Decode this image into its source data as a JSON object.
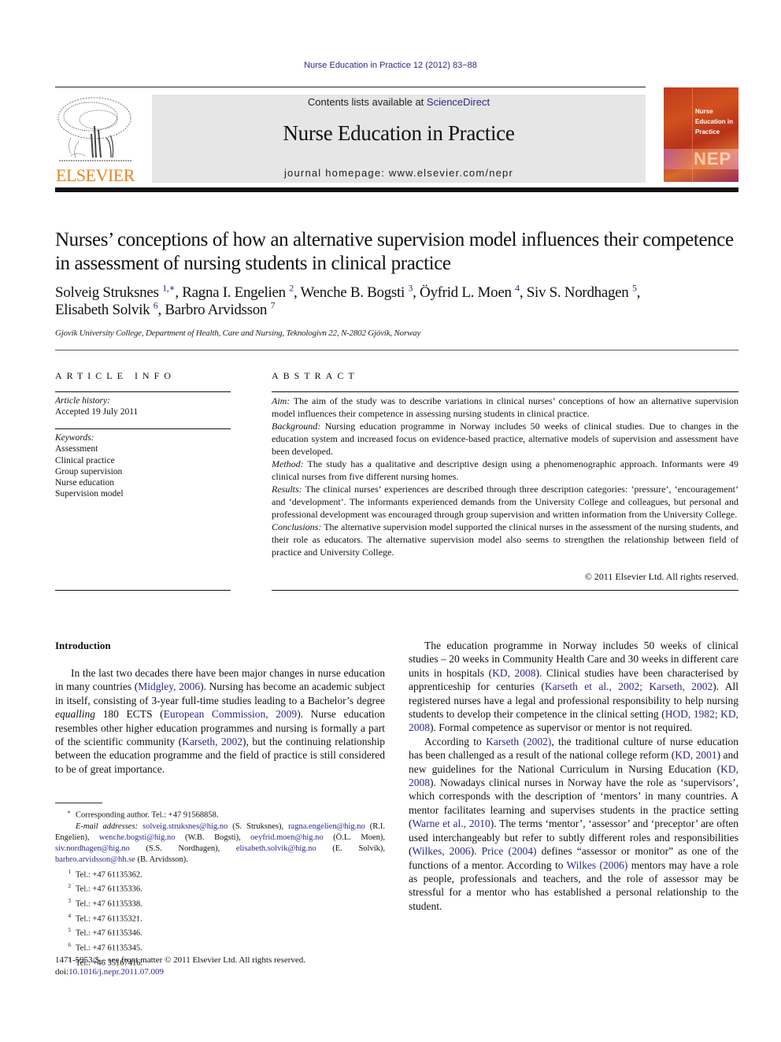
{
  "running_head": "Nurse Education in Practice 12 (2012) 83−88",
  "masthead": {
    "contents_prefix": "Contents lists available at ",
    "contents_link": "ScienceDirect",
    "journal_title": "Nurse Education in Practice",
    "homepage": "journal homepage: www.elsevier.com/nepr",
    "publisher_logo_text": "ELSEVIER",
    "cover": {
      "title_lines": [
        "Nurse",
        "Education in",
        "Practice"
      ],
      "abbrev": "NEP"
    }
  },
  "colors": {
    "link": "#2a2a8a",
    "elsevier_orange": "#e8821e",
    "masthead_bg": "#e6e6e6",
    "cover_red": "#c03a1c"
  },
  "article": {
    "title": "Nurses’ conceptions of how an alternative supervision model influences their competence in assessment of nursing students in clinical practice",
    "authors": [
      {
        "name": "Solveig Struksnes",
        "sup": "1,∗"
      },
      {
        "name": "Ragna I. Engelien",
        "sup": "2"
      },
      {
        "name": "Wenche B. Bogsti",
        "sup": "3"
      },
      {
        "name": "Öyfrid L. Moen",
        "sup": "4"
      },
      {
        "name": "Siv S. Nordhagen",
        "sup": "5"
      },
      {
        "name": "Elisabeth Solvik",
        "sup": "6"
      },
      {
        "name": "Barbro Arvidsson",
        "sup": "7"
      }
    ],
    "affiliation": "Gjovik University College, Department of Health, Care and Nursing, Teknologivn 22, N-2802 Gjövik, Norway"
  },
  "article_info": {
    "heading": "ARTICLE INFO",
    "history_label": "Article history:",
    "history_value": "Accepted 19 July 2011",
    "keywords_label": "Keywords:",
    "keywords": [
      "Assessment",
      "Clinical practice",
      "Group supervision",
      "Nurse education",
      "Supervision model"
    ]
  },
  "abstract": {
    "heading": "ABSTRACT",
    "sections": [
      {
        "label": "Aim:",
        "text": " The aim of the study was to describe variations in clinical nurses’ conceptions of how an alternative supervision model influences their competence in assessing nursing students in clinical practice."
      },
      {
        "label": "Background:",
        "text": " Nursing education programme in Norway includes 50 weeks of clinical studies. Due to changes in the education system and increased focus on evidence-based practice, alternative models of supervision and assessment have been developed."
      },
      {
        "label": "Method:",
        "text": " The study has a qualitative and descriptive design using a phenomenographic approach. Informants were 49 clinical nurses from five different nursing homes."
      },
      {
        "label": "Results:",
        "text": " The clinical nurses’ experiences are described through three description categories: ‘pressure’, ‘encouragement’ and ‘development’. The informants experienced demands from the University College and colleagues, but personal and professional development was encouraged through group supervision and written information from the University College."
      },
      {
        "label": "Conclusions:",
        "text": " The alternative supervision model supported the clinical nurses in the assessment of the nursing students, and their role as educators. The alternative supervision model also seems to strengthen the relationship between field of practice and University College."
      }
    ],
    "copyright": "© 2011 Elsevier Ltd. All rights reserved."
  },
  "body": {
    "intro_heading": "Introduction",
    "left_paragraph": [
      {
        "t": "In the last two decades there have been major changes in nurse education in many countries ("
      },
      {
        "link": "Midgley, 2006"
      },
      {
        "t": "). Nursing has become an academic subject in itself, consisting of 3-year full-time studies leading to a Bachelor’s degree "
      },
      {
        "em": "equalling"
      },
      {
        "t": " 180 ECTS ("
      },
      {
        "link": "European Commission, 2009"
      },
      {
        "t": "). Nurse education resembles other higher education programmes and nursing is formally a part of the scientific community ("
      },
      {
        "link": "Karseth, 2002"
      },
      {
        "t": "), but the continuing relationship between the education programme and the field of practice is still considered to be of great importance."
      }
    ],
    "right_paragraphs": [
      [
        {
          "t": "The education programme in Norway includes 50 weeks of clinical studies – 20 weeks in Community Health Care and 30 weeks in different care units in hospitals ("
        },
        {
          "link": "KD, 2008"
        },
        {
          "t": "). Clinical studies have been characterised by apprenticeship for centuries ("
        },
        {
          "link": "Karseth et al., 2002; Karseth, 2002"
        },
        {
          "t": "). All registered nurses have a legal and professional responsibility to help nursing students to develop their competence in the clinical setting ("
        },
        {
          "link": "HOD, 1982; KD, 2008"
        },
        {
          "t": "). Formal competence as supervisor or mentor is not required."
        }
      ],
      [
        {
          "t": "According to "
        },
        {
          "link": "Karseth (2002)"
        },
        {
          "t": ", the traditional culture of nurse education has been challenged as a result of the national college reform ("
        },
        {
          "link": "KD, 2001"
        },
        {
          "t": ") and new guidelines for the National Curriculum in Nursing Education ("
        },
        {
          "link": "KD, 2008"
        },
        {
          "t": "). Nowadays clinical nurses in Norway have the role as ‘supervisors’, which corresponds with the description of ‘mentors’ in many countries. A mentor facilitates learning and supervises students in the practice setting ("
        },
        {
          "link": "Warne et al., 2010"
        },
        {
          "t": "). The terms ‘mentor’, ‘assessor’ and ‘preceptor’ are often used interchangeably but refer to subtly different roles and responsibilities ("
        },
        {
          "link": "Wilkes, 2006"
        },
        {
          "t": "). "
        },
        {
          "link": "Price (2004)"
        },
        {
          "t": " defines “assessor or monitor” as one of the functions of a mentor. According to "
        },
        {
          "link": "Wilkes (2006)"
        },
        {
          "t": " mentors may have a role as people, professionals and teachers, and the role of assessor may be stressful for a mentor who has established a personal relationship to the student."
        }
      ]
    ]
  },
  "footnotes": {
    "corresponding": "Corresponding author. Tel.: +47 91568858.",
    "corresponding_mark": "∗",
    "email_label": "E-mail addresses:",
    "emails": [
      {
        "email": "solveig.struksnes@hig.no",
        "who": "S. Struksnes"
      },
      {
        "email": "ragna.engelien@hig.no",
        "who": "R.I. Engelien"
      },
      {
        "email": "wenche.bogsti@hig.no",
        "who": "W.B. Bogsti"
      },
      {
        "email": "oeyfrid.moen@hig.no",
        "who": "Ö.L. Moen"
      },
      {
        "email": "siv.nordhagen@hig.no",
        "who": "S.S. Nordhagen"
      },
      {
        "email": "elisabeth.solvik@hig.no",
        "who": "E. Solvik"
      },
      {
        "email": "barbro.arvidsson@hh.se",
        "who": "B. Arvidsson"
      }
    ],
    "phones": [
      {
        "n": "1",
        "text": "Tel.: +47 61135362."
      },
      {
        "n": "2",
        "text": "Tel.: +47 61135336."
      },
      {
        "n": "3",
        "text": "Tel.: +47 61135338."
      },
      {
        "n": "4",
        "text": "Tel.: +47 61135321."
      },
      {
        "n": "5",
        "text": "Tel.: +47 61135346."
      },
      {
        "n": "6",
        "text": "Tel.: +47 61135345."
      },
      {
        "n": "7",
        "text": "Tel.: +46 35167416."
      }
    ]
  },
  "front_matter": {
    "issn_line": "1471-5953/$ – see front matter © 2011 Elsevier Ltd. All rights reserved.",
    "doi_prefix": "doi:",
    "doi": "10.1016/j.nepr.2011.07.009"
  }
}
